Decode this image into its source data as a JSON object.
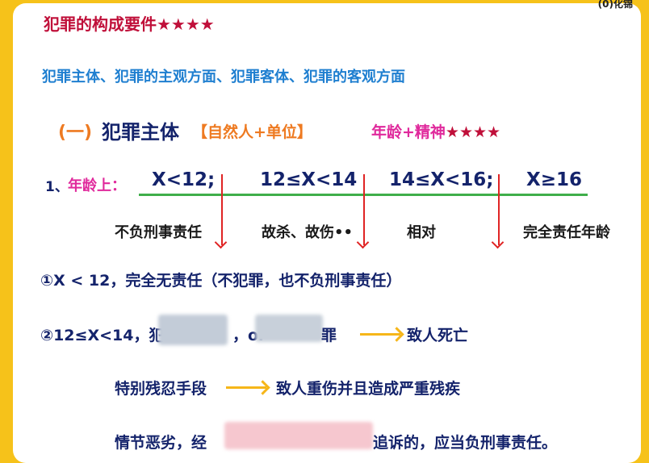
{
  "corner_mark": "(0)化锦",
  "title": {
    "text": "犯罪的构成要件",
    "stars": "★★★★"
  },
  "overview": "犯罪主体、犯罪的主观方面、犯罪客体、犯罪的客观方面",
  "section": {
    "number": "(一)",
    "title": "犯罪主体",
    "note": "【自然人+单位】",
    "age_mental": "年龄+精神",
    "stars": "★★★★"
  },
  "age": {
    "number": "1、",
    "label": "年龄上：",
    "ranges": [
      "X<12;",
      "12≤X<14",
      "14≤X<16;",
      "X≥16"
    ],
    "responsibilities": [
      "不负刑事责任",
      "故杀、故伤••",
      "相对",
      "完全责任年龄"
    ]
  },
  "rules": {
    "line1": "①X < 12，完全无责任（不犯罪，也不负刑事责任）",
    "line2_prefix": "②12≤X<14，犯",
    "line2_or": "，or",
    "line2_tail": "罪",
    "line2_result": "致人死亡",
    "line3_prefix": "特别残忍手段",
    "line3_result": "致人重伤并且造成严重残疾",
    "line4_prefix": "情节恶劣，经",
    "line4_suffix": "追诉的，应当负刑事责任。"
  },
  "colors": {
    "background": "#f6c21a",
    "title_red": "#c0103a",
    "overview_blue": "#1f7fd0",
    "navy": "#14236b",
    "orange": "#ee7a21",
    "magenta": "#e0299c",
    "green_line": "#3fae4a",
    "red_arrow": "#e02424",
    "yellow_arrow": "#f6b619"
  }
}
